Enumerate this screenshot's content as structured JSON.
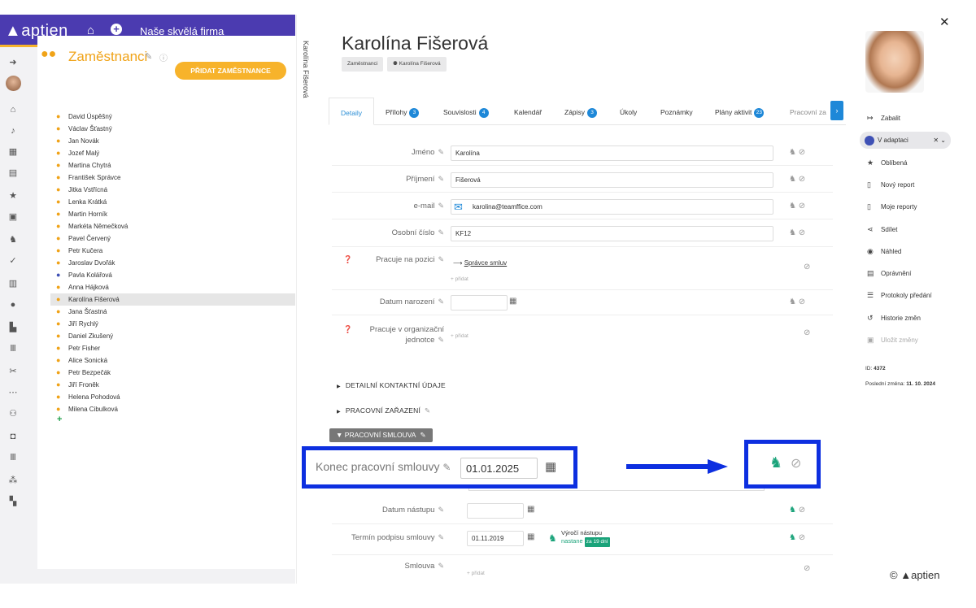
{
  "topbar": {
    "logo": "aptien",
    "company": "Naše skvělá firma"
  },
  "employees_panel": {
    "title": "Zaměstnanci",
    "add_button": "PŘIDAT ZAMĚSTNANCE",
    "list": [
      "David Úspěšný",
      "Václav Šťastný",
      "Jan Novák",
      "Jozef Malý",
      "Martina Chytrá",
      "František Správce",
      "Jitka Vstřícná",
      "Lenka Krátká",
      "Martin Horník",
      "Markéta Němečková",
      "Pavel Červený",
      "Petr Kučera",
      "Jaroslav Dvořák",
      "Pavla Kolářová",
      "Anna Hájková",
      "Karolína Fišerová",
      "Jana Šťastná",
      "Jiří Rychlý",
      "Daniel Zkušený",
      "Petr Fisher",
      "Alice Sonická",
      "Petr Bezpečák",
      "Jiří Froněk",
      "Helena Pohodová",
      "Milena Cibulková"
    ],
    "selected": "Karolína Fišerová"
  },
  "vertical_label": "Karolína Fišerová",
  "person": {
    "name": "Karolína Fišerová",
    "breadcrumb": [
      "Zaměstnanci",
      "Karolína Fišerová"
    ]
  },
  "tabs": [
    {
      "label": "Detaily",
      "count": null
    },
    {
      "label": "Přílohy",
      "count": "3"
    },
    {
      "label": "Souvislosti",
      "count": "4"
    },
    {
      "label": "Kalendář",
      "count": null
    },
    {
      "label": "Zápisy",
      "count": "3"
    },
    {
      "label": "Úkoly",
      "count": null
    },
    {
      "label": "Poznámky",
      "count": null
    },
    {
      "label": "Plány aktivit",
      "count": "23"
    },
    {
      "label": "Pracovní za",
      "count": null
    }
  ],
  "fields": {
    "first_name": {
      "label": "Jméno",
      "value": "Karolína"
    },
    "last_name": {
      "label": "Příjmení",
      "value": "Fišerová"
    },
    "email": {
      "label": "e-mail",
      "value": "karolina@teamffice.com"
    },
    "personal_number": {
      "label": "Osobní číslo",
      "value": "KF12"
    },
    "position": {
      "label": "Pracuje na pozici",
      "value": "Správce smluv",
      "add": "+ přidat"
    },
    "birth_date": {
      "label": "Datum narození",
      "value": ""
    },
    "org_unit": {
      "label_line1": "Pracuje v organizační",
      "label_line2": "jednotce",
      "add": "+ přidat"
    }
  },
  "sections": {
    "contact": "DETAILNÍ KONTAKTNÍ ÚDAJE",
    "job": "PRACOVNÍ ZAŘAZENÍ",
    "contract": "PRACOVNÍ SMLOUVA"
  },
  "contract": {
    "end": {
      "label": "Konec pracovní smlouvy",
      "value": "01.01.2025"
    },
    "start": {
      "label": "Datum nástupu",
      "value": ""
    },
    "signing": {
      "label": "Termín podpisu smlouvy",
      "value": "01.11.2019",
      "anniversary_title": "Výročí nástupu",
      "anniversary_status": "nastane",
      "anniversary_badge": "za 19 dní"
    },
    "contract_doc": {
      "label": "Smlouva",
      "add": "+ přidat"
    }
  },
  "right_panel": {
    "collapse": "Zabalit",
    "status": "V adaptaci",
    "actions": [
      "Oblíbená",
      "Nový report",
      "Moje reporty",
      "Sdílet",
      "Náhled",
      "Oprávnění",
      "Protokoly předání",
      "Historie změn",
      "Uložit změny"
    ],
    "id_label": "ID:",
    "id_value": "4372",
    "last_change_label": "Poslední změna:",
    "last_change_value": "11. 10. 2024"
  },
  "footer": {
    "copyright": "©",
    "brand": "aptien"
  },
  "colors": {
    "brand_purple": "#4b3bb0",
    "accent_orange": "#f7b32b",
    "tab_blue": "#1e88d8",
    "callout_blue": "#0d2fe0",
    "green": "#1aa37a"
  }
}
